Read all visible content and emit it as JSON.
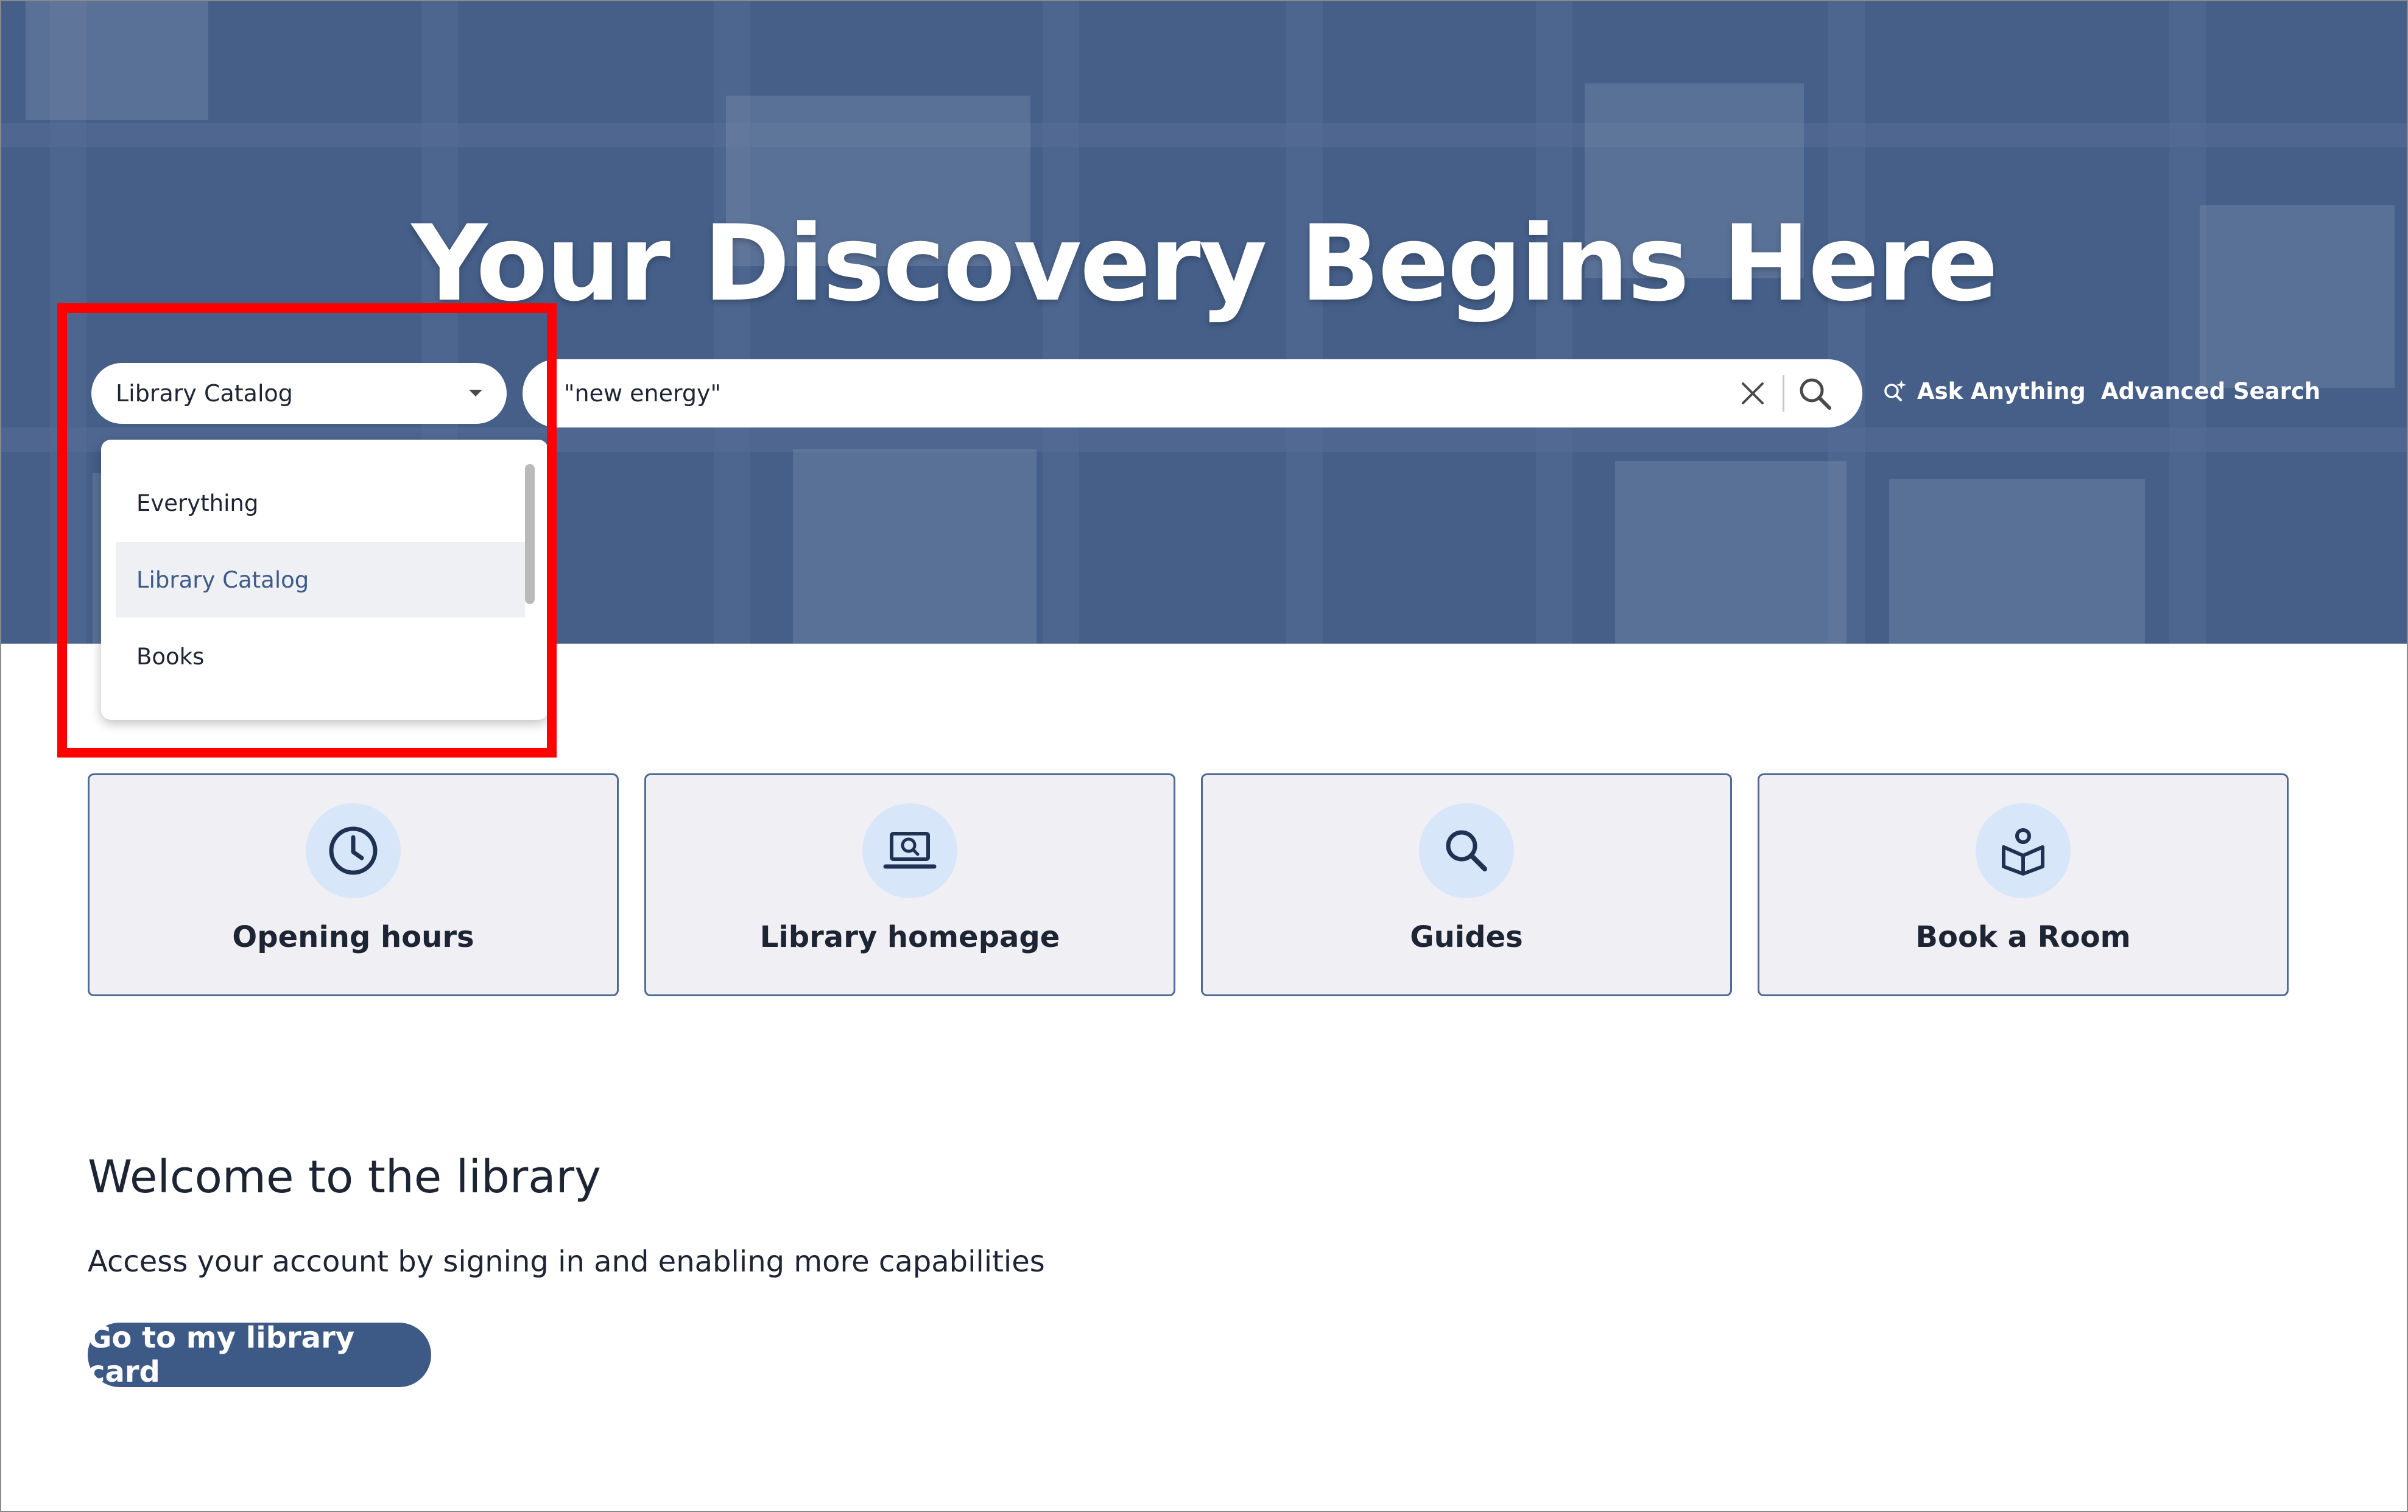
{
  "hero": {
    "title": "Your Discovery Begins Here"
  },
  "search": {
    "scope_selected": "Library Catalog",
    "query": "\"new energy\"",
    "ask_anything_label": "Ask Anything",
    "advanced_search_label": "Advanced Search",
    "scope_options": [
      "Everything",
      "Library Catalog",
      "Books"
    ]
  },
  "quick_links": [
    {
      "label": "Opening hours",
      "icon": "clock-icon"
    },
    {
      "label": "Library homepage",
      "icon": "laptop-search-icon"
    },
    {
      "label": "Guides",
      "icon": "magnifier-icon"
    },
    {
      "label": "Book a Room",
      "icon": "reading-room-icon"
    }
  ],
  "welcome": {
    "title": "Welcome to the library",
    "text": "Access your account by signing in and enabling more capabilities",
    "button_label": "Go to my library card"
  },
  "colors": {
    "accent": "#3d5a86",
    "highlight": "#ff0000",
    "card_bg": "#f0f0f4",
    "icon_bg": "#d8e6fa"
  }
}
